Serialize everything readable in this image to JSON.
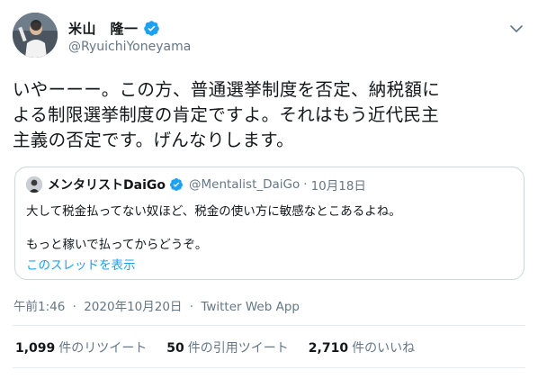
{
  "author": {
    "display_name": "米山　隆一",
    "handle": "@RyuichiYoneyama",
    "verified": true
  },
  "tweet": {
    "text_lines": [
      "いやーーー。この方、普通選挙制度を否定、納税額に",
      "よる制限選挙制度の肯定ですよ。それはもう近代民主",
      "主義の否定です。げんなりします。"
    ]
  },
  "quoted_tweet": {
    "display_name": "メンタリストDaiGo",
    "handle": "@Mentalist_DaiGo",
    "separator": "·",
    "date": "10月18日",
    "verified": true,
    "line1": "大して税金払ってない奴ほど、税金の使い方に敏感なとこあるよね。",
    "line2": "もっと稼いで払ってからどうぞ。",
    "thread_link": "このスレッドを表示"
  },
  "meta": {
    "time": "午前1:46",
    "separator1": "·",
    "date": "2020年10月20日",
    "separator2": "·",
    "source": "Twitter Web App"
  },
  "stats": {
    "retweets_count": "1,099",
    "retweets_label": "件のリツイート",
    "quotes_count": "50",
    "quotes_label": "件の引用ツイート",
    "likes_count": "2,710",
    "likes_label": "件のいいね"
  },
  "icons": {
    "verified": "verified-badge-icon",
    "menu": "chevron-down-icon",
    "accent": "#1da1f2",
    "secondary_text": "#657786"
  }
}
